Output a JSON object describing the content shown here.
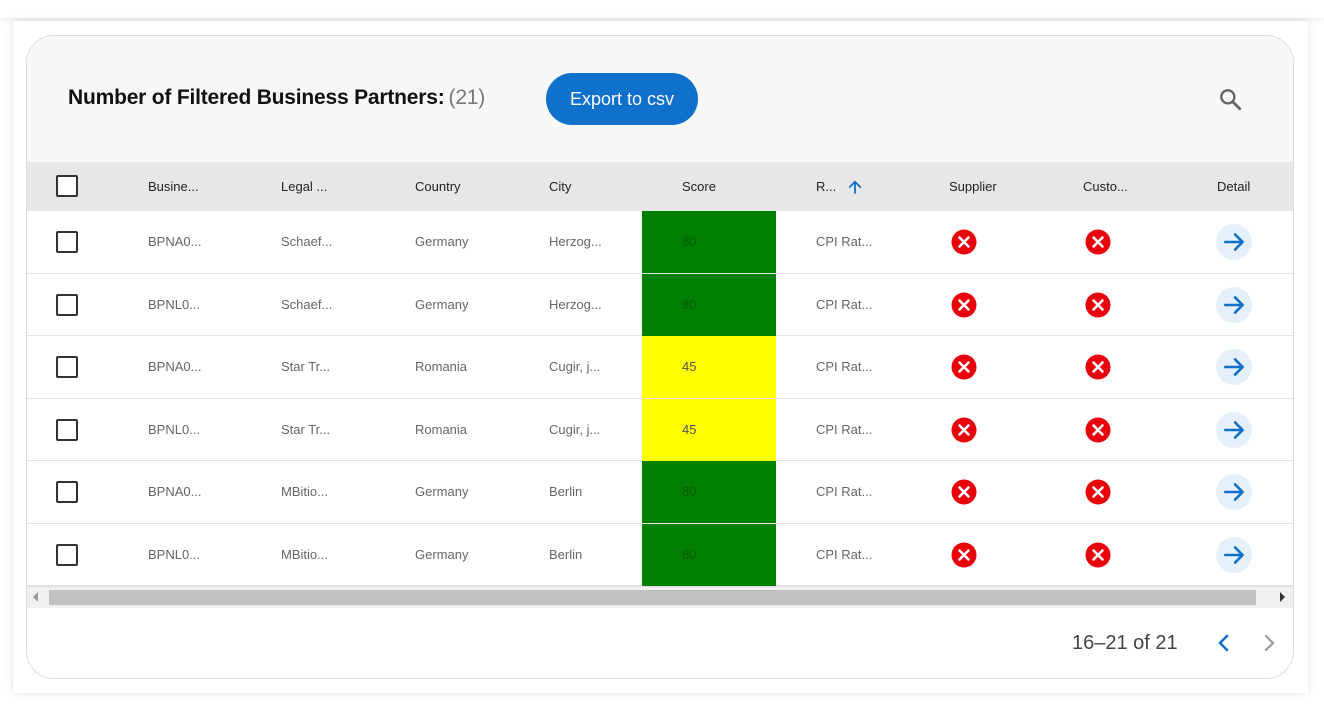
{
  "header": {
    "title": "Number of Filtered Business Partners:",
    "count": "(21)",
    "export_label": "Export to csv",
    "search_icon": "search-icon"
  },
  "columns": [
    "Busine...",
    "Legal ...",
    "Country",
    "City",
    "Score",
    "R...",
    "Supplier",
    "Custo...",
    "Detail"
  ],
  "sort": {
    "column": "R...",
    "direction": "ascending",
    "icon": "arrow-up-icon"
  },
  "rows": [
    {
      "bpn": "BPNA0...",
      "legal": "Schaef...",
      "country": "Germany",
      "city": "Herzog...",
      "score": "80",
      "rating": "CPI Rat...",
      "supplier": false,
      "customer": false
    },
    {
      "bpn": "BPNL0...",
      "legal": "Schaef...",
      "country": "Germany",
      "city": "Herzog...",
      "score": "80",
      "rating": "CPI Rat...",
      "supplier": false,
      "customer": false
    },
    {
      "bpn": "BPNA0...",
      "legal": "Star Tr...",
      "country": "Romania",
      "city": "Cugir, j...",
      "score": "45",
      "rating": "CPI Rat...",
      "supplier": false,
      "customer": false
    },
    {
      "bpn": "BPNL0...",
      "legal": "Star Tr...",
      "country": "Romania",
      "city": "Cugir, j...",
      "score": "45",
      "rating": "CPI Rat...",
      "supplier": false,
      "customer": false
    },
    {
      "bpn": "BPNA0...",
      "legal": "MBitio...",
      "country": "Germany",
      "city": "Berlin",
      "score": "80",
      "rating": "CPI Rat...",
      "supplier": false,
      "customer": false
    },
    {
      "bpn": "BPNL0...",
      "legal": "MBitio...",
      "country": "Germany",
      "city": "Berlin",
      "score": "80",
      "rating": "CPI Rat...",
      "supplier": false,
      "customer": false
    }
  ],
  "score_colors": {
    "80": "#008000",
    "45": "#ffff00"
  },
  "colors": {
    "accent": "#0f71cb",
    "error": "#e8000b",
    "header_bg": "#e7e7e7"
  },
  "pagination": {
    "label": "16–21 of 21",
    "prev_icon": "chevron-left-icon",
    "next_icon": "chevron-right-icon"
  }
}
